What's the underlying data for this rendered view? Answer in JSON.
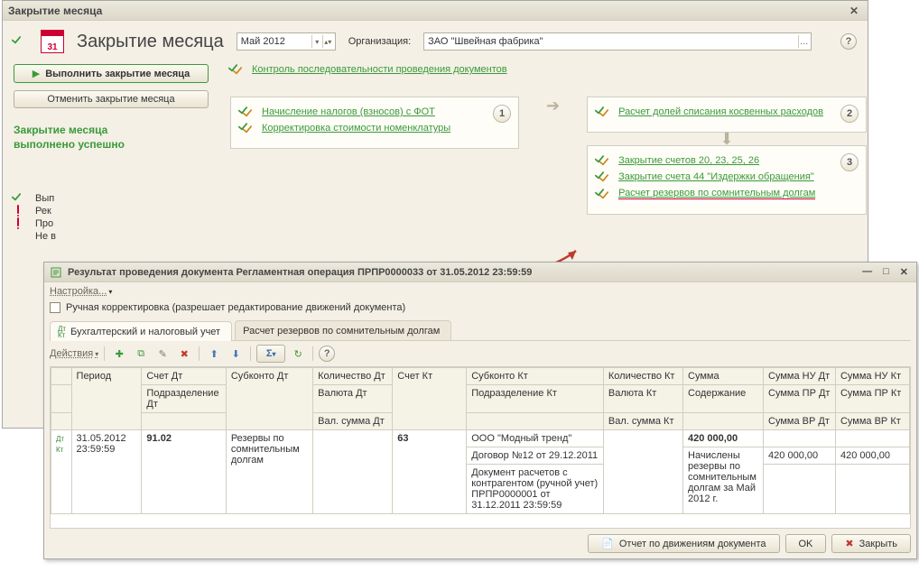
{
  "outer": {
    "title": "Закрытие месяца",
    "big_title": "Закрытие месяца",
    "cal_day": "31",
    "period": "Май 2012",
    "org_label": "Организация:",
    "org_value": "ЗАО \"Швейная фабрика\"",
    "control_link": "Контроль последовательности проведения документов",
    "btn_run": "Выполнить закрытие месяца",
    "btn_cancel": "Отменить закрытие месяца",
    "status_line1": "Закрытие месяца",
    "status_line2": "выполнено успешно",
    "stage1_a": "Начисление налогов (взносов) с ФОТ",
    "stage1_b": "Корректировка стоимости номенклатуры",
    "stage2_a": "Расчет долей списания косвенных расходов",
    "stage3_a": "Закрытие счетов 20, 23, 25, 26",
    "stage3_b": "Закрытие счета 44 \"Издержки обращения\"",
    "stage3_c": "Расчет резервов по сомнительным долгам",
    "num1": "1",
    "num2": "2",
    "num3": "3",
    "partial": [
      "Вып",
      "Рек",
      "Про",
      "Не в"
    ]
  },
  "inner": {
    "title": "Результат проведения документа Регламентная операция ПРПР0000033 от 31.05.2012 23:59:59",
    "settings": "Настройка...",
    "manual_edit": "Ручная корректировка (разрешает редактирование движений документа)",
    "tab1": "Бухгалтерский и налоговый учет",
    "tab2": "Расчет резервов по сомнительным долгам",
    "actions": "Действия",
    "headers": {
      "r1": [
        "",
        "Период",
        "Счет Дт",
        "Субконто Дт",
        "Количество Дт",
        "Счет Кт",
        "Субконто Кт",
        "Количество Кт",
        "Сумма",
        "Сумма НУ Дт",
        "Сумма НУ Кт"
      ],
      "r2": [
        "",
        "",
        "Подразделение Дт",
        "",
        "Валюта Дт",
        "",
        "Подразделение Кт",
        "",
        "Валюта Кт",
        "Содержание",
        "Сумма ПР Дт",
        "Сумма ПР Кт"
      ],
      "r3": [
        "",
        "",
        "",
        "",
        "Вал. сумма Дт",
        "",
        "",
        "",
        "Вал. сумма Кт",
        "",
        "Сумма ВР Дт",
        "Сумма ВР Кт"
      ]
    },
    "row": {
      "period1": "31.05.2012",
      "period2": "23:59:59",
      "dt": "91.02",
      "sub_dt": "Резервы по сомнительным долгам",
      "kt": "63",
      "sub_kt1": "ООО \"Модный тренд\"",
      "sub_kt2": "Договор №12 от 29.12.2011",
      "sub_kt3": "Документ расчетов с контрагентом (ручной учет) ПРПР0000001 от 31.12.2011 23:59:59",
      "sum": "420 000,00",
      "desc": "Начислены резервы по сомнительным долгам за Май 2012 г.",
      "nu_dt": "420 000,00",
      "nu_kt": "420 000,00"
    },
    "footer_report": "Отчет по движениям документа",
    "btn_ok": "OK",
    "btn_close": "Закрыть"
  }
}
